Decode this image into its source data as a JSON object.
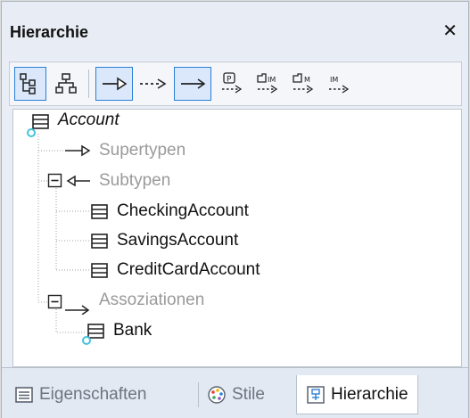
{
  "window": {
    "title": "Hierarchie",
    "close_glyph": "✕"
  },
  "toolbar": {
    "buttons": [
      {
        "name": "tree-view-button",
        "icon": "tree-view-icon",
        "active": true
      },
      {
        "name": "graph-view-button",
        "icon": "graph-view-icon",
        "active": false
      },
      {
        "name": "generalization-button",
        "icon": "generalization-arrow-icon",
        "active": true
      },
      {
        "name": "realization-button",
        "icon": "dashed-arrow-icon",
        "active": false
      },
      {
        "name": "association-button",
        "icon": "association-arrow-icon",
        "active": true
      },
      {
        "name": "package-import-button",
        "icon": "package-import-icon",
        "label": "P"
      },
      {
        "name": "merge-button",
        "icon": "package-merge-icon",
        "label": "IM"
      },
      {
        "name": "merge-button-2",
        "icon": "package-merge-icon",
        "label": "M"
      },
      {
        "name": "import-button",
        "icon": "import-icon",
        "label": "IM"
      }
    ]
  },
  "tree": {
    "root": "Account",
    "groups": {
      "supertypes": "Supertypen",
      "subtypes": "Subtypen",
      "associations": "Assoziationen"
    },
    "subtypes": [
      "CheckingAccount",
      "SavingsAccount",
      "CreditCardAccount"
    ],
    "associations": [
      "Bank"
    ]
  },
  "tabs": [
    {
      "label": "Eigenschaften",
      "icon": "properties-icon",
      "active": false
    },
    {
      "label": "Stile",
      "icon": "palette-icon",
      "active": false
    },
    {
      "label": "Hierarchie",
      "icon": "hierarchy-icon",
      "active": true
    }
  ],
  "colors": {
    "accent": "#2a7fd6",
    "group_text": "#9a9a9a",
    "connector": "#44c4dc"
  }
}
